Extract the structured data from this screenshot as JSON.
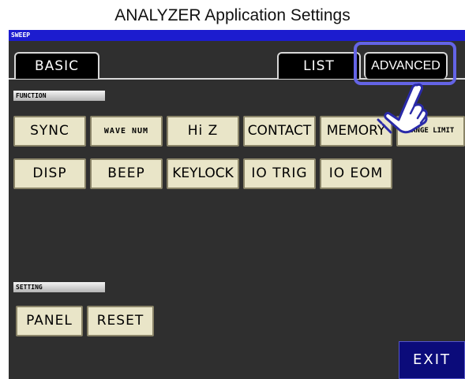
{
  "window": {
    "title": "ANALYZER Application Settings"
  },
  "topbar": {
    "mode_label": "SWEEP"
  },
  "tabs": {
    "basic": "BASIC",
    "list": "LIST",
    "advanced": "ADVANCED"
  },
  "function_section": {
    "label": "FUNCTION",
    "row1": [
      "SYNC",
      "WAVE NUM",
      "Hi Z",
      "CONTACT",
      "MEMORY",
      "RANGE LIMIT"
    ],
    "row2": [
      "DISP",
      "BEEP",
      "KEYLOCK",
      "IO TRIG",
      "IO EOM"
    ]
  },
  "setting_section": {
    "label": "SETTING",
    "buttons": [
      "PANEL",
      "RESET"
    ]
  },
  "footer": {
    "exit_label": "EXIT"
  },
  "colors": {
    "topbar": "#1c1ccf",
    "screen_bg": "#2f2f2f",
    "button_bg": "#e9e5c8",
    "highlight": "#6464e6",
    "exit_bg": "#0b0b7a"
  },
  "icons": {
    "pointer": "pointing-hand-icon"
  }
}
